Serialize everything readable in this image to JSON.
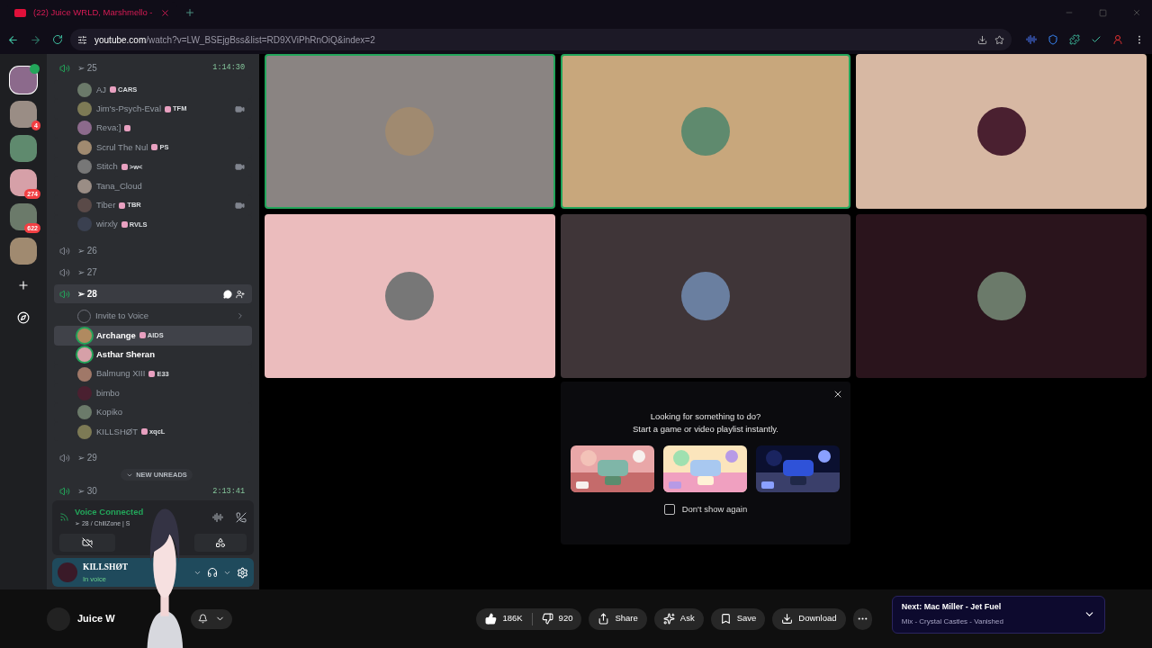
{
  "browser": {
    "tab_title": "(22) Juice WRLD, Marshmello -",
    "url_host": "youtube.com",
    "url_path": "/watch?v=LW_BSEjgBss&list=RD9XViPhRnOiQ&index=2"
  },
  "servers": [
    {
      "speaker": true,
      "selected": true
    },
    {
      "badge": "4",
      "speaker": false,
      "selected": false
    },
    {
      "speaker": false,
      "selected": false
    },
    {
      "badge": "274",
      "speaker": false,
      "selected": false
    },
    {
      "badge": "622",
      "speaker": false,
      "selected": false
    },
    {
      "speaker": false,
      "selected": false
    }
  ],
  "channels": [
    {
      "name": "➢ 25",
      "active": true,
      "selected": false,
      "time": "1:14:30",
      "members": [
        {
          "name": "AJ",
          "tag": "CARS",
          "tag_icon": true,
          "video": false,
          "speaking": false,
          "bright": false,
          "highlighted": false
        },
        {
          "name": "Jim's-Psych-Eval",
          "tag": "TFM",
          "tag_icon": true,
          "video": true,
          "speaking": false,
          "bright": false,
          "highlighted": false
        },
        {
          "name": "Reva:]",
          "tag_icon": true,
          "video": false,
          "speaking": false,
          "bright": false,
          "highlighted": false
        },
        {
          "name": "Scrul The Nul",
          "tag": "PS",
          "tag_icon": true,
          "video": false,
          "speaking": false,
          "bright": false,
          "highlighted": false
        },
        {
          "name": "Stitch",
          "tag": ">w<",
          "tag_icon": true,
          "video": true,
          "speaking": false,
          "bright": false,
          "highlighted": false
        },
        {
          "name": "Tana_Cloud",
          "tag_icon": false,
          "video": false,
          "speaking": false,
          "bright": false,
          "highlighted": false
        },
        {
          "name": "Tiber",
          "tag": "TBR",
          "tag_icon": true,
          "video": true,
          "speaking": false,
          "bright": false,
          "highlighted": false
        },
        {
          "name": "wirxly",
          "tag": "RVLS",
          "tag_icon": true,
          "video": false,
          "speaking": false,
          "bright": false,
          "highlighted": false
        }
      ]
    },
    {
      "name": "➢ 26",
      "active": false,
      "selected": false
    },
    {
      "name": "➢ 27",
      "active": false,
      "selected": false
    },
    {
      "name": "➢ 28",
      "active": true,
      "selected": true,
      "invite": "Invite to Voice",
      "members": [
        {
          "name": "Archange",
          "tag": "AIDS",
          "tag_icon": true,
          "video": false,
          "speaking": true,
          "bright": true,
          "highlighted": true
        },
        {
          "name": "Asthar Sheran",
          "tag_icon": false,
          "video": false,
          "speaking": true,
          "bright": true,
          "highlighted": false
        },
        {
          "name": "Balmung XIII",
          "tag": "E33",
          "tag_icon": true,
          "video": false,
          "speaking": false,
          "bright": false,
          "highlighted": false
        },
        {
          "name": "bimbo",
          "tag_icon": false,
          "video": false,
          "speaking": false,
          "bright": false,
          "highlighted": false
        },
        {
          "name": "Kopiko",
          "tag_icon": false,
          "video": false,
          "speaking": false,
          "bright": false,
          "highlighted": false
        },
        {
          "name": "KILLSHØT",
          "tag": "xqcL",
          "tag_icon": true,
          "video": false,
          "speaking": false,
          "bright": false,
          "highlighted": false
        }
      ]
    },
    {
      "name": "➢ 29",
      "active": false,
      "selected": false
    },
    {
      "name": "➢ 30",
      "active": true,
      "selected": false,
      "time": "2:13:41"
    }
  ],
  "new_unreads": "NEW UNREADS",
  "voice": {
    "status": "Voice Connected",
    "channel": "➢ 28 / ChillZone | S"
  },
  "user": {
    "name": "KILLSHØT",
    "status": "In voice"
  },
  "tiles": [
    {
      "color": "#8a8482",
      "speaking": true
    },
    {
      "color": "#c8a77c",
      "speaking": true
    },
    {
      "color": "#d7b8a3",
      "speaking": false
    },
    {
      "color": "#ebbcbd",
      "speaking": false
    },
    {
      "color": "#3f3538",
      "speaking": false
    },
    {
      "color": "#2a141c",
      "speaking": false
    }
  ],
  "activity_popup": {
    "line1": "Looking for something to do?",
    "line2": "Start a game or video playlist instantly.",
    "dont_show": {
      "label": "Don't show again",
      "checked": false
    }
  },
  "youtube": {
    "channel": "Juice W",
    "likes": "186K",
    "dislikes": "920",
    "actions": [
      "Share",
      "Ask",
      "Save",
      "Download"
    ],
    "next_title": "Next: Mac Miller - Jet Fuel",
    "next_sub": "Mix - Crystal Castles - Vanished"
  }
}
